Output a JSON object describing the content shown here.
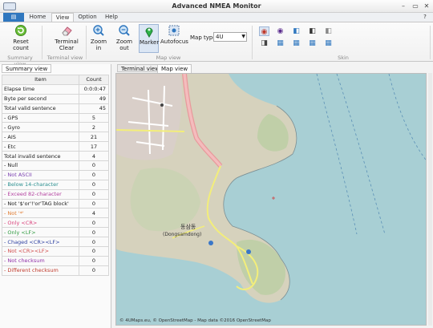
{
  "window": {
    "title": "Advanced NMEA Monitor",
    "controls": [
      "–",
      "▭",
      "✕"
    ]
  },
  "ribbon_tabs": [
    {
      "label": "Home"
    },
    {
      "label": "View"
    },
    {
      "label": "Option"
    },
    {
      "label": "Help"
    }
  ],
  "ribbon": {
    "reset_count": "Reset count",
    "terminal_clear": "Terminal Clear",
    "zoom_in": "Zoom in",
    "zoom_out": "Zoom out",
    "marker": "Marker",
    "autofocus": "Autofocus",
    "map_type_label": "Map type",
    "map_type_value": "4U",
    "groups": {
      "summary": "Summary view",
      "terminal": "Terminal view",
      "map": "Map view",
      "skin": "Skin"
    }
  },
  "left_tab": "Summary view",
  "table": {
    "headers": [
      "Item",
      "Count"
    ],
    "rows": [
      {
        "item": "Elapse time",
        "count": "0:0:0:47",
        "color": "#1a1a1a",
        "align": "right"
      },
      {
        "item": "Byte per second",
        "count": "49",
        "color": "#1a1a1a",
        "align": "right"
      },
      {
        "item": "Total valid sentence",
        "count": "45",
        "color": "#1a1a1a",
        "align": "right"
      },
      {
        "item": " - GPS",
        "count": "5",
        "color": "#1a1a1a",
        "align": "center"
      },
      {
        "item": " - Gyro",
        "count": "2",
        "color": "#1a1a1a",
        "align": "center"
      },
      {
        "item": " - AIS",
        "count": "21",
        "color": "#1a1a1a",
        "align": "center"
      },
      {
        "item": " - Etc",
        "count": "17",
        "color": "#1a1a1a",
        "align": "center"
      },
      {
        "item": "Total invalid sentence",
        "count": "4",
        "color": "#1a1a1a",
        "align": "center"
      },
      {
        "item": " - Null",
        "count": "0",
        "color": "#1a1a1a",
        "align": "center"
      },
      {
        "item": " - Not ASCII",
        "count": "0",
        "color": "#7a3fb0",
        "align": "center"
      },
      {
        "item": " - Below 14-character",
        "count": "0",
        "color": "#2a8f8f",
        "align": "center"
      },
      {
        "item": " - Exceed 82-character",
        "count": "0",
        "color": "#b3409f",
        "align": "center"
      },
      {
        "item": " - Not '$'or'!'or'TAG block'",
        "count": "0",
        "color": "#1a1a1a",
        "align": "center"
      },
      {
        "item": " - Not '*'",
        "count": "4",
        "color": "#e07a2e",
        "align": "center"
      },
      {
        "item": " - Only <CR>",
        "count": "0",
        "color": "#d9407a",
        "align": "center"
      },
      {
        "item": " - Only <LF>",
        "count": "0",
        "color": "#2f9a3f",
        "align": "center"
      },
      {
        "item": " - Chaged <CR><LF>",
        "count": "0",
        "color": "#2c3fa0",
        "align": "center"
      },
      {
        "item": " - Not <CR><LF>",
        "count": "0",
        "color": "#d04a4a",
        "align": "center"
      },
      {
        "item": " - Not checksum",
        "count": "0",
        "color": "#8f2fa8",
        "align": "center"
      },
      {
        "item": " - Different checksum",
        "count": "0",
        "color": "#c0392b",
        "align": "center"
      }
    ]
  },
  "right_tabs": [
    "Terminal view",
    "Map view"
  ],
  "map": {
    "place_korean": "동삼동",
    "place_roman": "(Dongsamdong)",
    "attribution": "© 4UMaps.eu, © OpenStreetMap - Map data ©2016 OpenStreetMap"
  },
  "colors": {
    "accent": "#2f77bf",
    "sea": "#a8cfd4",
    "land": "#d6d2bd",
    "road": "#e89a9c",
    "trail": "#f3ee7a"
  }
}
